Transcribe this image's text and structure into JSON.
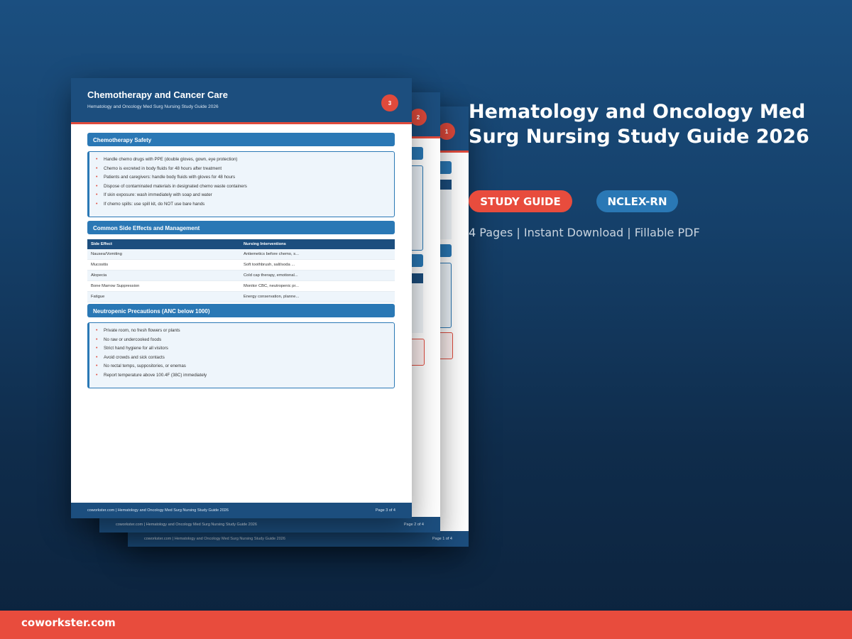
{
  "product": {
    "title": "Hematology and Oncology Med Surg Nursing Study Guide 2026",
    "tags": [
      {
        "label": "STUDY GUIDE",
        "color": "#e84c3d"
      },
      {
        "label": "NCLEX-RN",
        "color": "#2a78b5"
      }
    ],
    "meta": "4 Pages | Instant Download | Fillable PDF"
  },
  "pages": [
    {
      "number": "1",
      "footer_left": "coworkster.com | Hematology and Oncology Med Surg Nursing Study Guide 2026",
      "footer_right": "Page 1 of 4"
    },
    {
      "number": "2",
      "footer_left": "coworkster.com | Hematology and Oncology Med Surg Nursing Study Guide 2026",
      "footer_right": "Page 2 of 4"
    },
    {
      "number": "3",
      "title": "Chemotherapy and Cancer Care",
      "subtitle": "Hematology and Oncology Med Surg Nursing Study Guide 2026",
      "footer_left": "coworkster.com | Hematology and Oncology Med Surg Nursing Study Guide 2026",
      "footer_right": "Page 3 of 4",
      "sections": [
        {
          "heading": "Chemotherapy Safety",
          "bullets": [
            "Handle chemo drugs with PPE (double gloves, gown, eye protection)",
            "Chemo is excreted in body fluids for 48 hours after treatment",
            "Patients and caregivers: handle body fluids with gloves for 48 hours",
            "Dispose of contaminated materials in designated chemo waste containers",
            "If skin exposure: wash immediately with soap and water",
            "If chemo spills: use spill kit, do NOT use bare hands"
          ]
        },
        {
          "heading": "Common Side Effects and Management",
          "table": {
            "headers": [
              "Side Effect",
              "Nursing Interventions"
            ],
            "rows": [
              [
                "Nausea/Vomiting",
                "Antiemetics before chemo, s..."
              ],
              [
                "Mucositis",
                "Soft toothbrush, salt/soda ..."
              ],
              [
                "Alopecia",
                "Cold cap therapy, emotional..."
              ],
              [
                "Bone Marrow Suppression",
                "Monitor CBC, neutropenic pr..."
              ],
              [
                "Fatigue",
                "Energy conservation, planne..."
              ]
            ]
          }
        },
        {
          "heading": "Neutropenic Precautions (ANC below 1000)",
          "bullets": [
            "Private room, no fresh flowers or plants",
            "No raw or undercooked foods",
            "Strict hand hygiene for all visitors",
            "Avoid crowds and sick contacts",
            "No rectal temps, suppositories, or enemas",
            "Report temperature above 100.4F (38C) immediately"
          ]
        }
      ]
    }
  ],
  "site": "coworkster.com"
}
